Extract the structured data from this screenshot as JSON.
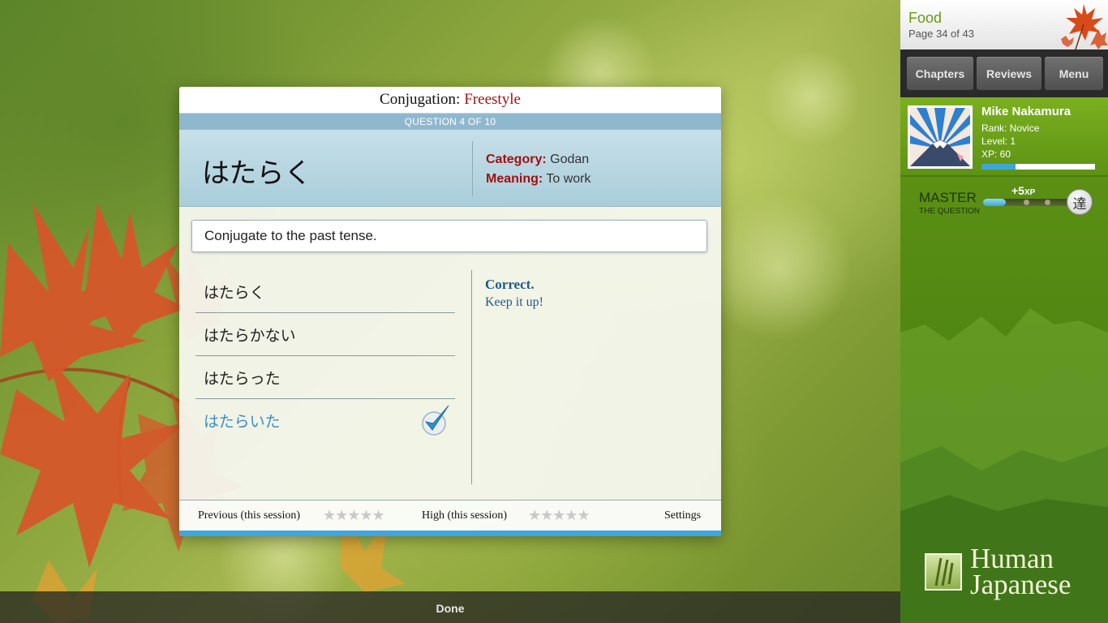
{
  "quiz": {
    "title_prefix": "Conjugation:",
    "title_mode": "Freestyle",
    "question_counter": "QUESTION 4 OF 10",
    "word": "はたらく",
    "category_label": "Category:",
    "category_value": "Godan",
    "meaning_label": "Meaning:",
    "meaning_value": "To work",
    "prompt": "Conjugate to the past tense.",
    "answers": [
      {
        "text": "はたらく"
      },
      {
        "text": "はたらかない"
      },
      {
        "text": "はたらった"
      },
      {
        "text": "はたらいた"
      }
    ],
    "feedback_title": "Correct.",
    "feedback_message": "Keep it up!",
    "footer": {
      "previous_label": "Previous (this session)",
      "previous_stars": "★★★★★",
      "high_label": "High (this session)",
      "high_stars": "★★★★★",
      "settings_label": "Settings"
    }
  },
  "bottom_bar": {
    "done_label": "Done"
  },
  "sidebar": {
    "chapter_title": "Food",
    "chapter_page": "Page 34 of 43",
    "nav": {
      "chapters_label": "Chapters",
      "reviews_label": "Reviews",
      "menu_label": "Menu"
    },
    "profile": {
      "name": "Mike Nakamura",
      "rank": "Rank:  Novice",
      "level": "Level:  1",
      "xp": "XP:  60",
      "xp_progress": 0.3
    },
    "master": {
      "label": "MASTER",
      "sub_label": "THE QUESTION",
      "bonus_value": "+5",
      "bonus_unit": "XP",
      "kanji": "達",
      "progress": 0.25
    },
    "logo": {
      "line1": "Human",
      "line2": "Japanese"
    }
  },
  "colors": {
    "accent_red": "#a01010",
    "correct_blue": "#3b8fc1",
    "sidebar_green": "#5b8f14",
    "progress_blue": "#3da6d8"
  }
}
